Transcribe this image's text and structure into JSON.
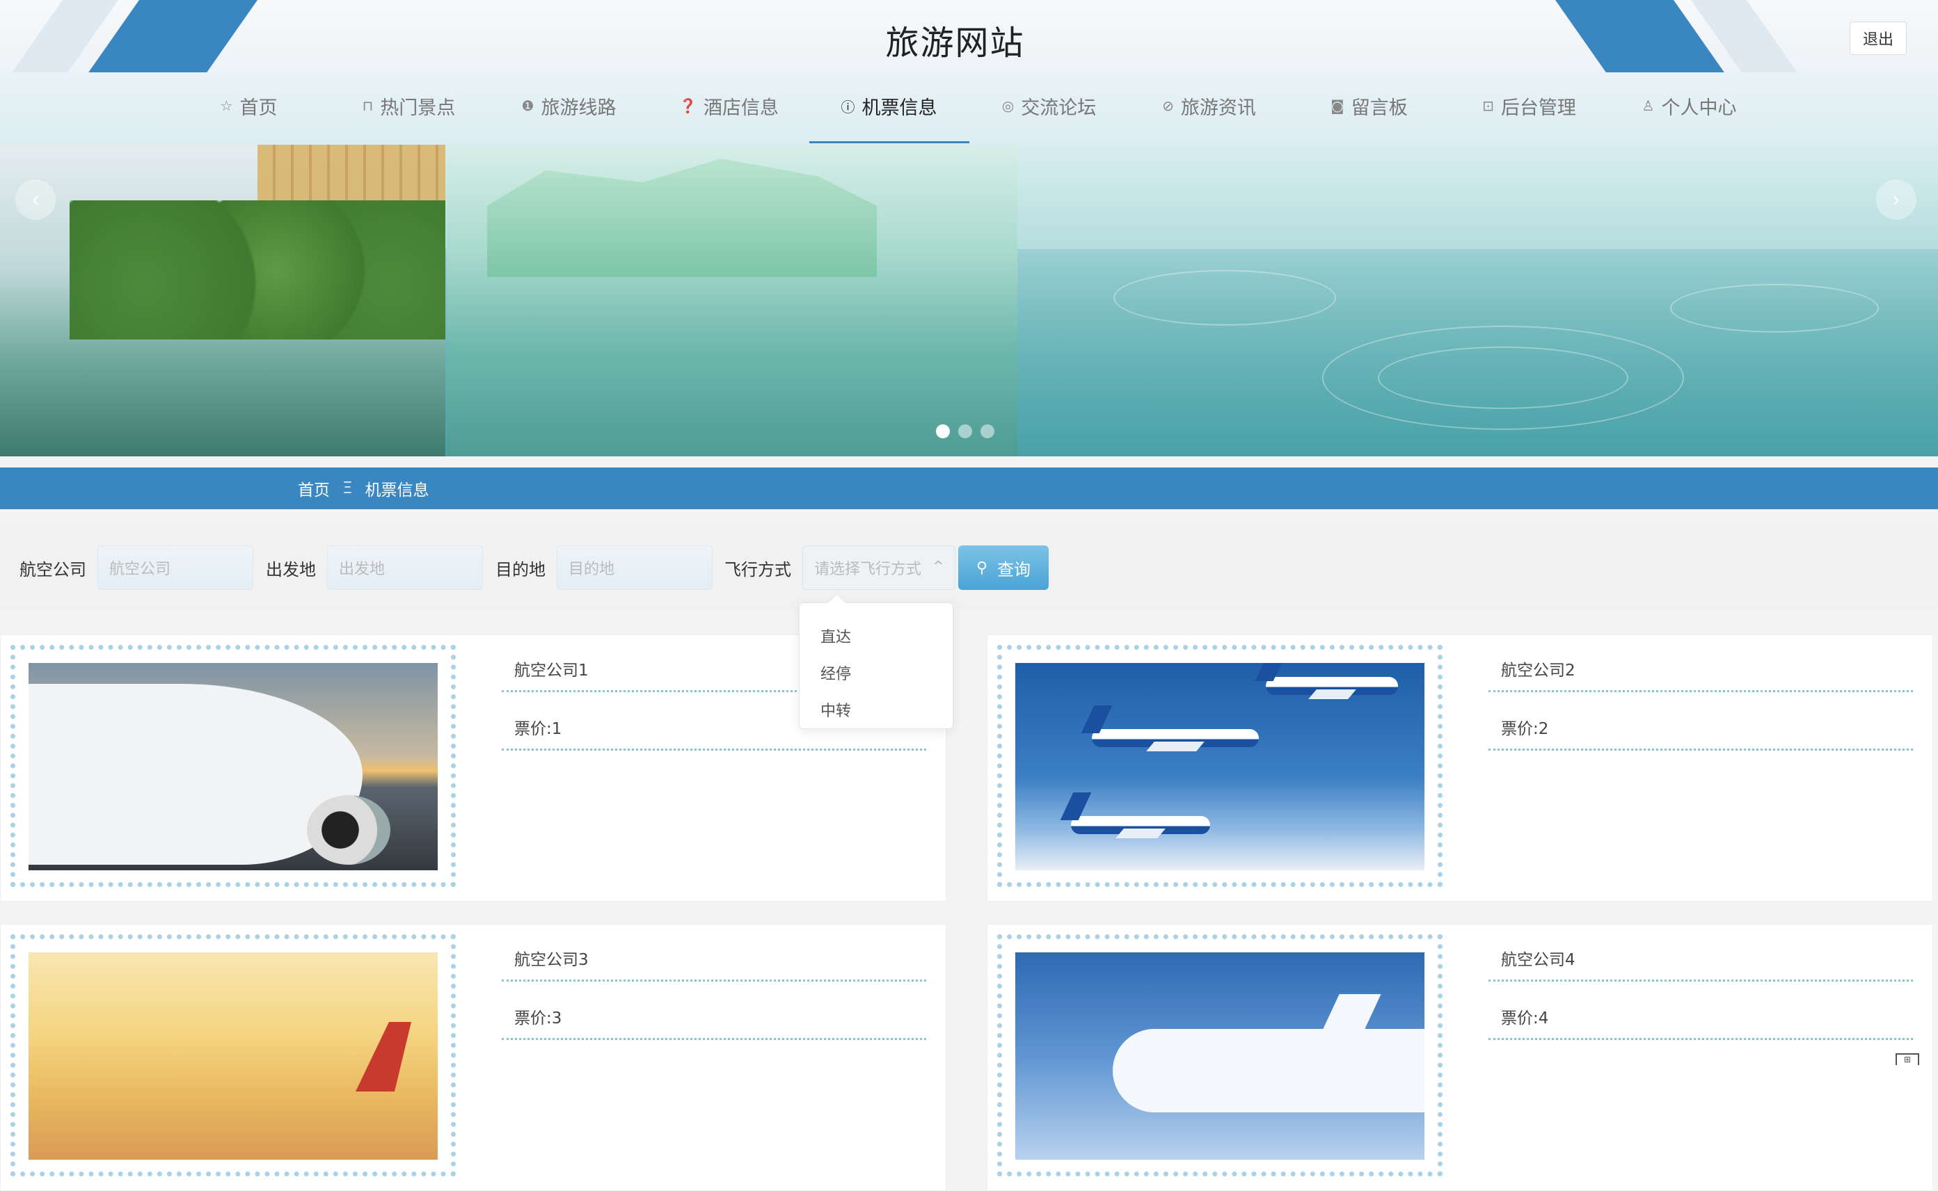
{
  "header": {
    "title": "旅游网站",
    "logout_label": "退出"
  },
  "nav": {
    "items": [
      {
        "label": "首页",
        "icon": "star-icon",
        "glyph": "☆"
      },
      {
        "label": "热门景点",
        "icon": "lock-icon",
        "glyph": "⊓"
      },
      {
        "label": "旅游线路",
        "icon": "alert-circle-icon",
        "glyph": "❶"
      },
      {
        "label": "酒店信息",
        "icon": "question-circle-icon",
        "glyph": "❓"
      },
      {
        "label": "机票信息",
        "icon": "info-circle-icon",
        "glyph": "ⓘ",
        "active": true
      },
      {
        "label": "交流论坛",
        "icon": "target-icon",
        "glyph": "◎"
      },
      {
        "label": "旅游资讯",
        "icon": "check-circle-icon",
        "glyph": "⊘"
      },
      {
        "label": "留言板",
        "icon": "camera-icon",
        "glyph": "◙"
      },
      {
        "label": "后台管理",
        "icon": "briefcase-icon",
        "glyph": "⊡"
      },
      {
        "label": "个人中心",
        "icon": "user-icon",
        "glyph": "♙"
      }
    ]
  },
  "banner": {
    "prev_icon": "chevron-left-icon",
    "next_icon": "chevron-right-icon",
    "dots": 3,
    "active_dot": 0
  },
  "breadcrumb": {
    "home": "首页",
    "separator": "Ξ",
    "current": "机票信息"
  },
  "search": {
    "airline": {
      "label": "航空公司",
      "placeholder": "航空公司"
    },
    "origin": {
      "label": "出发地",
      "placeholder": "出发地"
    },
    "destination": {
      "label": "目的地",
      "placeholder": "目的地"
    },
    "flight_mode": {
      "label": "飞行方式",
      "placeholder": "请选择飞行方式",
      "options": [
        "直达",
        "经停",
        "中转"
      ]
    },
    "query_label": "查询"
  },
  "cards": [
    {
      "airline": "航空公司1",
      "price": "票价:1"
    },
    {
      "airline": "航空公司2",
      "price": "票价:2"
    },
    {
      "airline": "航空公司3",
      "price": "票价:3"
    },
    {
      "airline": "航空公司4",
      "price": "票价:4"
    }
  ],
  "colors": {
    "accent": "#3a86c0",
    "stamp_border": "#a9d2e6",
    "divider": "#8ac5cf"
  }
}
